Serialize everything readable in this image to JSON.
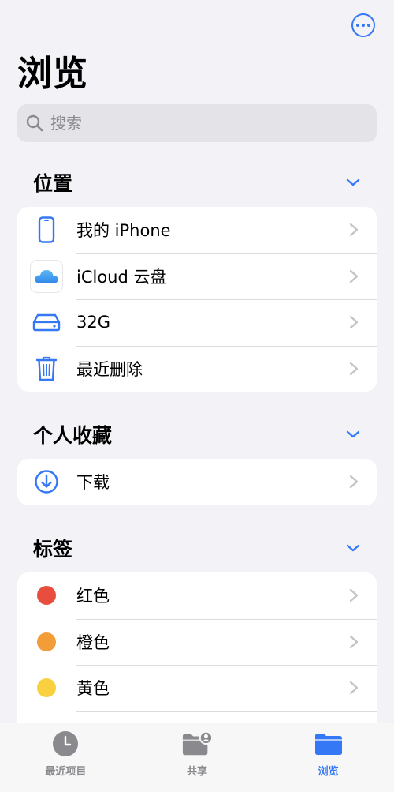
{
  "header": {
    "title": "浏览"
  },
  "search": {
    "placeholder": "搜索"
  },
  "sections": [
    {
      "title": "位置",
      "items": [
        {
          "label": "我的 iPhone",
          "icon": "iphone-icon"
        },
        {
          "label": "iCloud 云盘",
          "icon": "icloud-icon"
        },
        {
          "label": "32G",
          "icon": "drive-icon"
        },
        {
          "label": "最近删除",
          "icon": "trash-icon"
        }
      ]
    },
    {
      "title": "个人收藏",
      "items": [
        {
          "label": "下载",
          "icon": "download-icon"
        }
      ]
    },
    {
      "title": "标签",
      "items": [
        {
          "label": "红色",
          "color": "#e94d3d"
        },
        {
          "label": "橙色",
          "color": "#f29d38"
        },
        {
          "label": "黄色",
          "color": "#f9d13e"
        }
      ]
    }
  ],
  "tabbar": {
    "tabs": [
      {
        "label": "最近项目",
        "icon": "clock-icon"
      },
      {
        "label": "共享",
        "icon": "shared-folder-icon"
      },
      {
        "label": "浏览",
        "icon": "folder-icon",
        "active": true
      }
    ]
  },
  "colors": {
    "accent": "#3478f6"
  }
}
